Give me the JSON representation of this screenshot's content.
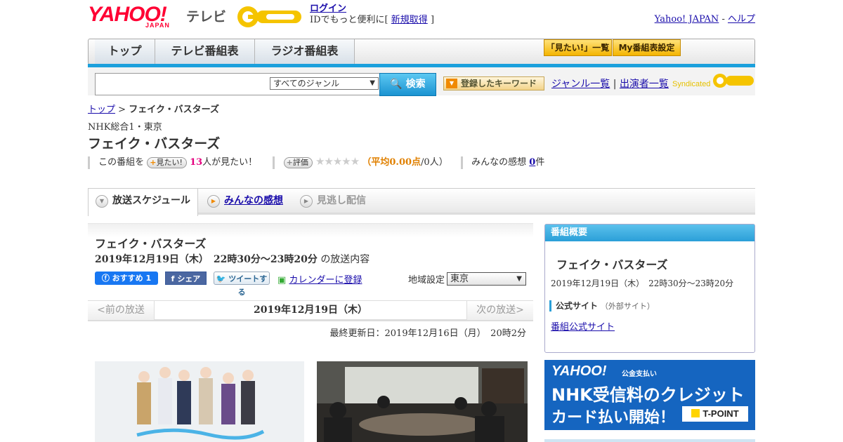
{
  "header": {
    "logo_text": "YAHOO!",
    "logo_sub": "JAPAN",
    "service_name": "テレビ",
    "login_label": "ログイン",
    "id_prefix": "IDでもっと便利に[",
    "signup_label": "新規取得",
    "id_suffix": "]",
    "yahoo_japan_link": "Yahoo! JAPAN",
    "separator": "-",
    "help_link": "ヘルプ"
  },
  "nav": {
    "tabs": [
      "トップ",
      "テレビ番組表",
      "ラジオ番組表"
    ],
    "buttons": [
      "「見たい!」一覧",
      "My番組表設定"
    ]
  },
  "search": {
    "placeholder": "",
    "genre_selected": "すべてのジャンル",
    "search_button": "検索",
    "keyword_button": "登録したキーワード",
    "genre_list_link": "ジャンル一覧",
    "pipe": "|",
    "performer_link": "出演者一覧",
    "syndicated": "Syndicated"
  },
  "breadcrumb": {
    "home": "トップ",
    "sep": ">",
    "current": "フェイク・バスターズ"
  },
  "program": {
    "channel": "NHK総合1・東京",
    "title": "フェイク・バスターズ",
    "want_prefix": "この番組を",
    "want_button": "見たい!",
    "want_count": "13",
    "want_suffix": "人が見たい！",
    "rate_button": "評価",
    "stars": "★★★★★",
    "rating_open": "（",
    "rating_avg": "平均0.00点",
    "rating_rest": "/0人）",
    "impressions_label": "みんなの感想",
    "impressions_count": "0",
    "impressions_unit": "件"
  },
  "tabs": [
    {
      "label": "放送スケジュール",
      "state": "active"
    },
    {
      "label": "みんなの感想",
      "state": "link"
    },
    {
      "label": "見逃し配信",
      "state": "disabled"
    }
  ],
  "broadcast": {
    "title": "フェイク・バスターズ",
    "date": "2019年12月19日（木）　22時30分～23時20分",
    "date_suffix": "の放送内容",
    "fb_like": "おすすめ 1",
    "fb_share": "シェア",
    "tweet": "ツイートする",
    "calendar": "カレンダーに登録",
    "region_label": "地域設定",
    "region_value": "東京"
  },
  "pager": {
    "prev": "<前の放送",
    "current": "2019年12月19日（木）",
    "next": "次の放送>"
  },
  "updated": "最終更新日：2019年12月16日（月）　20時2分",
  "summary": {
    "header": "番組概要",
    "title": "フェイク・バスターズ",
    "date": "2019年12月19日（木）　22時30分～23時20分",
    "official_label": "公式サイト",
    "official_note": "（外部サイト）",
    "official_link": "番組公式サイト"
  },
  "ad": {
    "brand": "YAHOO!",
    "brand_sub": "公金支払い",
    "line1": "NHK受信料のクレジット",
    "line2": "カード払い開始！",
    "tpoint": "T-POINT"
  },
  "colors": {
    "accent_blue": "#1ba0dc",
    "brand_red": "#ff0033",
    "want_pink": "#e4007f",
    "rating_orange": "#e08000"
  }
}
